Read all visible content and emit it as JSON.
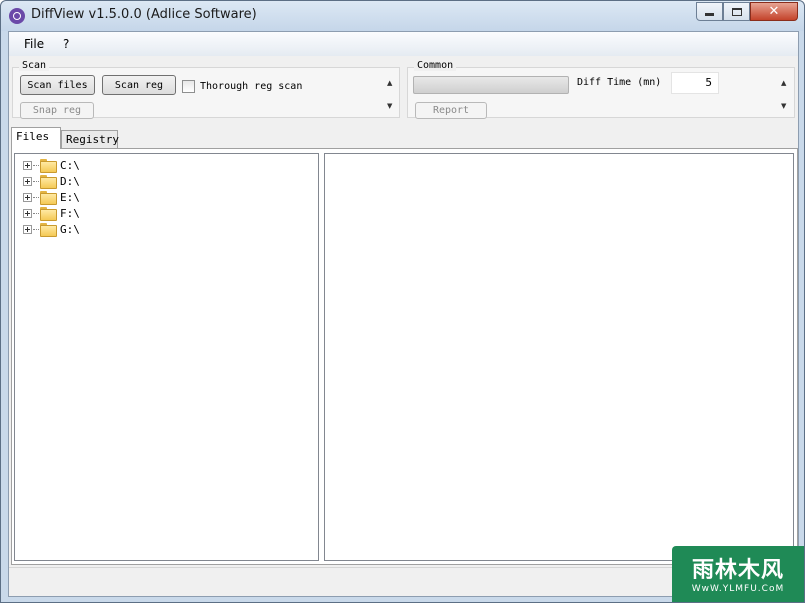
{
  "window": {
    "title": "DiffView v1.5.0.0 (Adlice Software)",
    "close_glyph": "✕"
  },
  "menu": {
    "items": [
      {
        "label": "File"
      },
      {
        "label": "?"
      }
    ]
  },
  "scan_group": {
    "label": "Scan",
    "scan_files_label": "Scan files",
    "scan_reg_label": "Scan reg",
    "thorough_label": "Thorough reg scan",
    "thorough_checked": false,
    "snap_reg_label": "Snap reg"
  },
  "common_group": {
    "label": "Common",
    "progress": 0,
    "diff_time_label": "Diff Time (mn)",
    "diff_time_value": "5",
    "report_label": "Report"
  },
  "tabs": [
    {
      "label": "Files",
      "active": true
    },
    {
      "label": "Registry",
      "active": false
    }
  ],
  "tree": {
    "drives": [
      {
        "label": "C:\\"
      },
      {
        "label": "D:\\"
      },
      {
        "label": "E:\\"
      },
      {
        "label": "F:\\"
      },
      {
        "label": "G:\\"
      }
    ]
  },
  "scroll": {
    "up_glyph": "▲",
    "down_glyph": "▼"
  },
  "watermark": {
    "main": "雨林木风",
    "site": "WwW.YLMFU.CoM"
  },
  "colors": {
    "titlebar": "#c5d6e9",
    "close_button": "#c4432b",
    "folder": "#f4c955",
    "watermark": "#1f8a56"
  }
}
